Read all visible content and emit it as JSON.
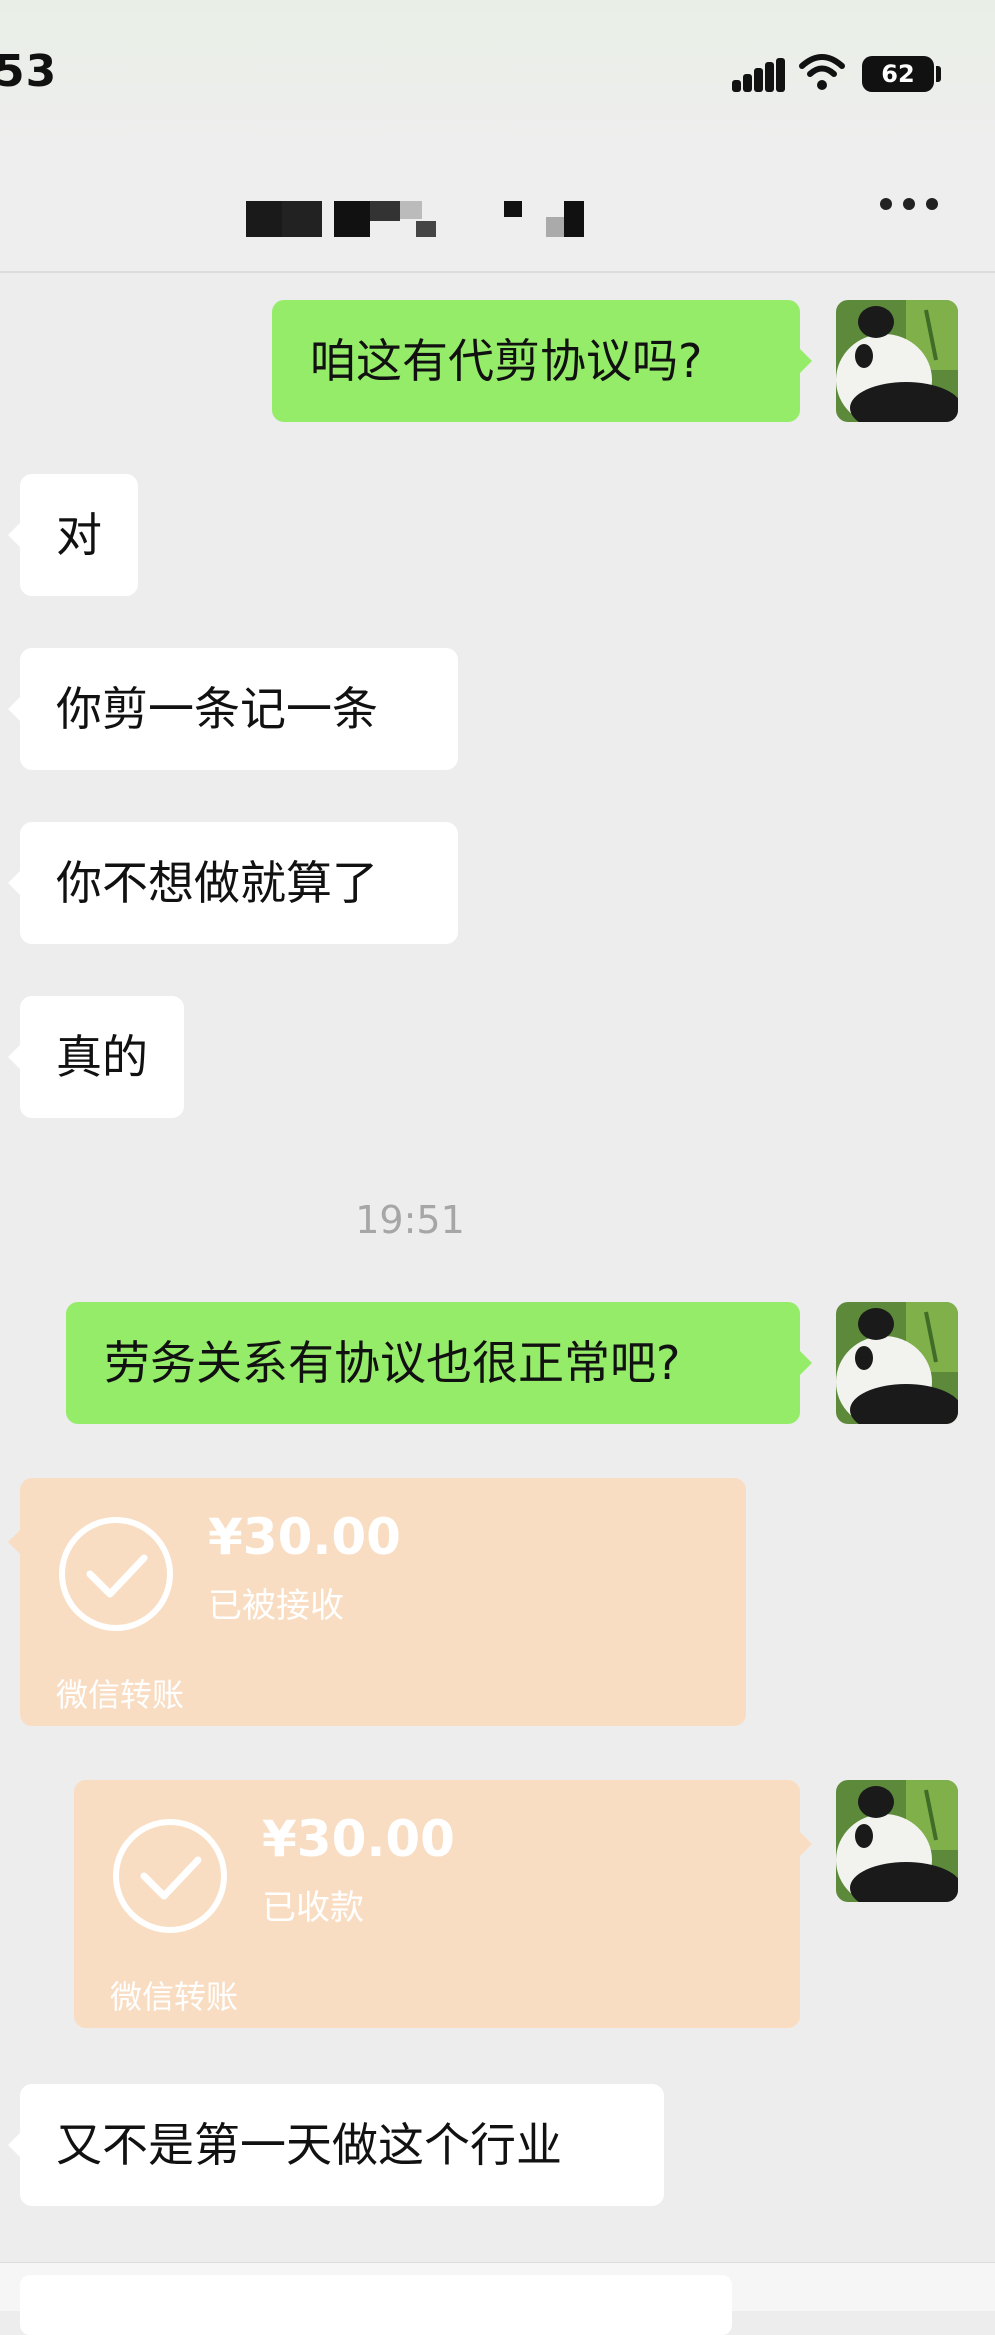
{
  "status_bar": {
    "time": "53",
    "battery": "62"
  },
  "nav": {
    "title_pixelated": true
  },
  "messages": [
    {
      "side": "out",
      "text": "咱这有代剪协议吗?"
    },
    {
      "side": "in",
      "text": "对"
    },
    {
      "side": "in",
      "text": "你剪一条记一条"
    },
    {
      "side": "in",
      "text": "你不想做就算了"
    },
    {
      "side": "in",
      "text": "真的"
    },
    {
      "timestamp": "19:51"
    },
    {
      "side": "out",
      "text": "劳务关系有协议也很正常吧?"
    },
    {
      "side": "in",
      "transfer": {
        "amount": "¥30.00",
        "status": "已被接收",
        "label": "微信转账"
      }
    },
    {
      "side": "out",
      "transfer": {
        "amount": "¥30.00",
        "status": "已收款",
        "label": "微信转账"
      }
    },
    {
      "side": "in",
      "text": "又不是第一天做这个行业"
    }
  ],
  "colors": {
    "out_bubble": "#95ec69",
    "in_bubble": "#ffffff",
    "transfer": "#f9ddc2",
    "background": "#ededed"
  },
  "icons": {
    "more": "more-icon",
    "transfer": "transfer-check-icon",
    "avatar": "panda-avatar"
  }
}
